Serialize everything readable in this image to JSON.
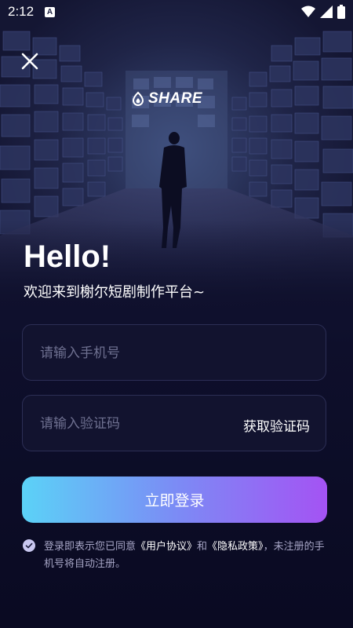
{
  "status_bar": {
    "time": "2:12",
    "notification_badge": "A",
    "icons": [
      "wifi-icon",
      "signal-icon",
      "battery-icon"
    ]
  },
  "brand": {
    "logo_text": "SHARE",
    "logo_icon": "flame-drop-icon"
  },
  "header": {
    "greeting": "Hello!",
    "welcome": "欢迎来到榭尔短剧制作平台~"
  },
  "form": {
    "phone_placeholder": "请输入手机号",
    "phone_value": "",
    "code_placeholder": "请输入验证码",
    "code_value": "",
    "get_code_label": "获取验证码",
    "submit_label": "立即登录"
  },
  "agreement": {
    "checked": true,
    "prefix": "登录即表示您已同意",
    "user_agreement": "《用户协议》",
    "and": "和",
    "privacy_policy": "《隐私政策》",
    "suffix": "，未注册的手机号将自动注册。"
  },
  "colors": {
    "background": "#0e0f2b",
    "field_border": "#2c2e55",
    "placeholder": "#6e7090",
    "button_gradient_start": "#5bd2f7",
    "button_gradient_end": "#a453f3",
    "agreement_text": "#a7a6c6"
  }
}
